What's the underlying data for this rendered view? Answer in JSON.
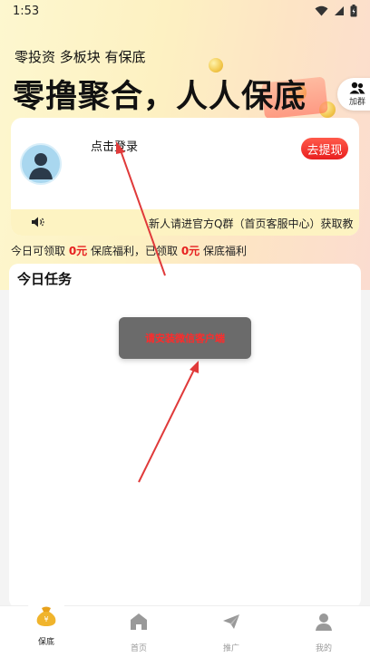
{
  "status_bar": {
    "time": "1:53"
  },
  "hero": {
    "slogan_small": "零投资 多板块 有保底",
    "slogan_big": "零撸聚合，人人保底",
    "group_button_label": "加群"
  },
  "profile_card": {
    "login_text": "点击登录",
    "withdraw_label": "去提现",
    "notice_text": "新人请进官方Q群（首页客服中心）获取教"
  },
  "welfare": {
    "prefix": "今日可领取 ",
    "today_amount": "0元",
    "middle": " 保底福利，已领取 ",
    "claimed_amount": "0元",
    "suffix": " 保底福利"
  },
  "tasks": {
    "title": "今日任务"
  },
  "toast": {
    "message": "请安装微信客户端"
  },
  "tabbar": {
    "items": [
      {
        "label": "保底",
        "icon": "money-bag-icon",
        "active": true
      },
      {
        "label": "首页",
        "icon": "home-icon",
        "active": false
      },
      {
        "label": "推广",
        "icon": "paper-plane-icon",
        "active": false
      },
      {
        "label": "我的",
        "icon": "person-icon",
        "active": false
      }
    ]
  },
  "colors": {
    "accent_red": "#e62020",
    "notice_bg": "#fdf3c2",
    "toast_bg": "#6b6b6b",
    "annotation_arrow": "#e03a3a"
  }
}
